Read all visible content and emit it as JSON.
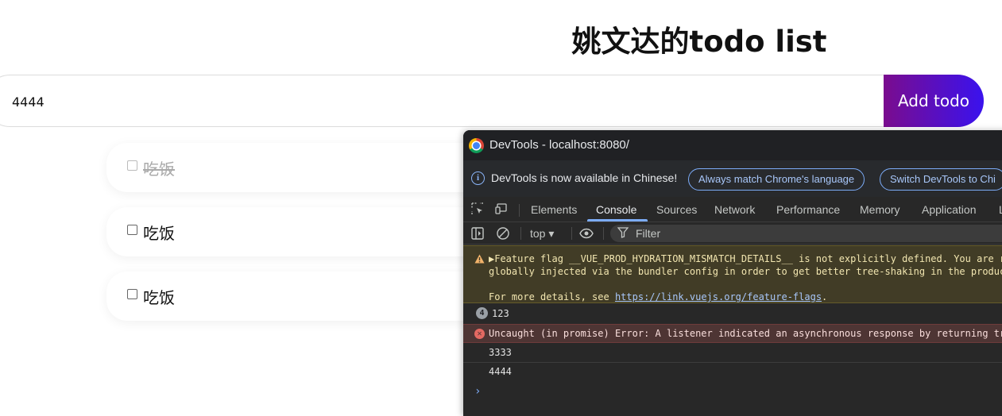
{
  "page": {
    "title": "姚文达的todo list",
    "input_value": "4444",
    "add_button_label": "Add todo"
  },
  "todos": [
    {
      "text": "吃饭",
      "completed": true
    },
    {
      "text": "吃饭",
      "completed": false
    },
    {
      "text": "吃饭",
      "completed": false
    }
  ],
  "devtools": {
    "window_title": "DevTools - localhost:8080/",
    "infobar": {
      "message": "DevTools is now available in Chinese!",
      "match_language_button": "Always match Chrome's language",
      "switch_button": "Switch DevTools to Chi"
    },
    "tabs": [
      "Elements",
      "Console",
      "Sources",
      "Network",
      "Performance",
      "Memory",
      "Application",
      "L"
    ],
    "active_tab": "Console",
    "toolbar": {
      "context": "top ▾",
      "filter_placeholder": "Filter"
    },
    "console": {
      "warning": {
        "line1": "▶Feature flag __VUE_PROD_HYDRATION_MISMATCH_DETAILS__ is not explicitly defined. You are ru",
        "line2": "globally injected via the bundler config in order to get better tree-shaking in the producti",
        "line3_prefix": "For more details, see ",
        "link": "https://link.vuejs.org/feature-flags",
        "line3_suffix": "."
      },
      "grouped_log": {
        "count": "4",
        "text": "123"
      },
      "error": "Uncaught (in promise) Error: A listener indicated an asynchronous response by returning true",
      "logs": [
        "3333",
        "4444"
      ],
      "prompt": "›"
    }
  },
  "colors": {
    "add_button_gradient_start": "#7a0c8e",
    "add_button_gradient_end": "#3a12ee",
    "devtools_bg": "#282828",
    "accent_blue": "#7cacf8",
    "warning_bg": "#413c26",
    "error_bg": "#4e3534"
  }
}
